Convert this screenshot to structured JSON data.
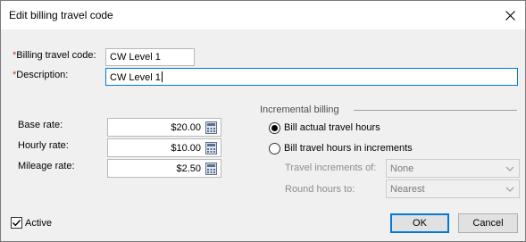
{
  "dialog": {
    "title": "Edit billing travel code"
  },
  "fields": {
    "billing_travel_code": {
      "required_mark": "*",
      "label": "Billing travel code:",
      "value": "CW Level 1"
    },
    "description": {
      "required_mark": "*",
      "label": "Description:",
      "value": "CW Level 1"
    },
    "base_rate": {
      "label": "Base rate:",
      "value": "$20.00"
    },
    "hourly_rate": {
      "label": "Hourly rate:",
      "value": "$10.00"
    },
    "mileage_rate": {
      "label": "Mileage rate:",
      "value": "$2.50"
    }
  },
  "incremental_billing": {
    "group_label": "Incremental billing",
    "option_actual": "Bill actual travel hours",
    "option_increments": "Bill travel hours in increments",
    "selected_option": "Bill actual travel hours",
    "travel_increments_label": "Travel increments of:",
    "travel_increments_value": "None",
    "round_hours_label": "Round hours to:",
    "round_hours_value": "Nearest"
  },
  "active": {
    "label": "Active",
    "checked": true
  },
  "buttons": {
    "ok": "OK",
    "cancel": "Cancel"
  },
  "colors": {
    "focus_border": "#0078d7",
    "required": "#c0392b"
  }
}
